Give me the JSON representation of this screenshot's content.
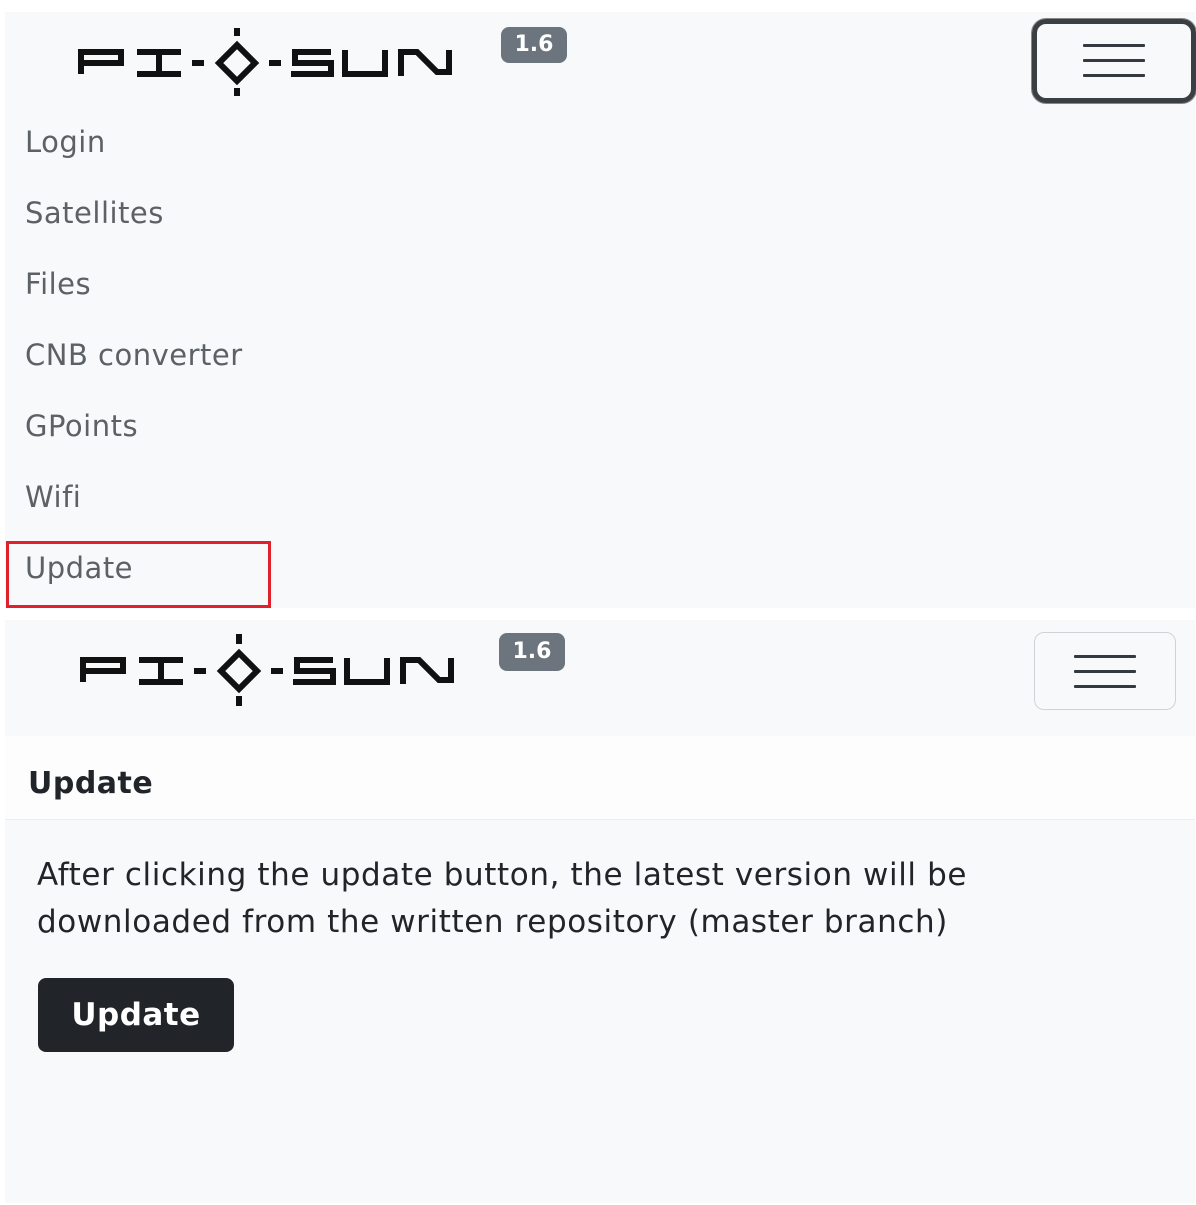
{
  "top_navbar": {
    "brand": "PI-SUN",
    "version": "1.6",
    "toggler_icon": "hamburger-icon"
  },
  "nav_menu": {
    "items": [
      {
        "label": "Login"
      },
      {
        "label": "Satellites"
      },
      {
        "label": "Files"
      },
      {
        "label": "CNB converter"
      },
      {
        "label": "GPoints"
      },
      {
        "label": "Wifi"
      },
      {
        "label": "Update"
      }
    ],
    "highlighted_item": "Update",
    "highlight_color": "#e0202a"
  },
  "bottom_navbar": {
    "brand": "PI-SUN",
    "version": "1.6",
    "toggler_icon": "hamburger-icon"
  },
  "update_card": {
    "title": "Update",
    "description": "After clicking the update button, the latest version will be downloaded from the written repository (master branch)",
    "button_label": "Update"
  },
  "colors": {
    "badge": "#6c757d",
    "button": "#212529",
    "background": "#f8f9fa"
  }
}
